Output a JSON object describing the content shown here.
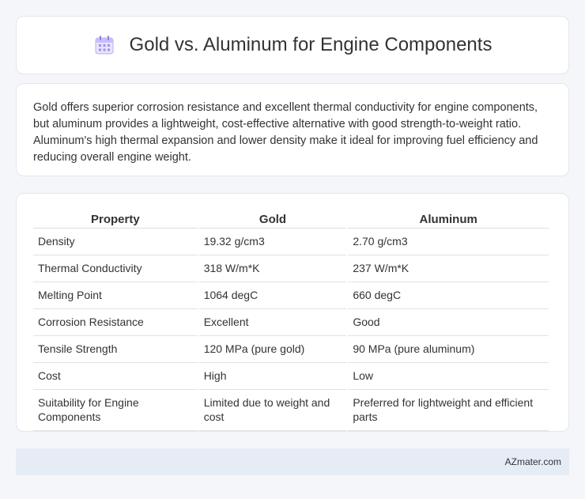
{
  "header": {
    "title": "Gold vs. Aluminum for Engine Components",
    "icon": "calendar-icon"
  },
  "summary": {
    "text": "Gold offers superior corrosion resistance and excellent thermal conductivity for engine components, but aluminum provides a lightweight, cost-effective alternative with good strength-to-weight ratio. Aluminum's high thermal expansion and lower density make it ideal for improving fuel efficiency and reducing overall engine weight."
  },
  "table": {
    "headers": [
      "Property",
      "Gold",
      "Aluminum"
    ],
    "rows": [
      [
        "Density",
        "19.32 g/cm3",
        "2.70 g/cm3"
      ],
      [
        "Thermal Conductivity",
        "318 W/m*K",
        "237 W/m*K"
      ],
      [
        "Melting Point",
        "1064 degC",
        "660 degC"
      ],
      [
        "Corrosion Resistance",
        "Excellent",
        "Good"
      ],
      [
        "Tensile Strength",
        "120 MPa (pure gold)",
        "90 MPa (pure aluminum)"
      ],
      [
        "Cost",
        "High",
        "Low"
      ],
      [
        "Suitability for Engine Components",
        "Limited due to weight and cost",
        "Preferred for lightweight and efficient parts"
      ]
    ]
  },
  "footer": {
    "text": "AZmater.com"
  }
}
